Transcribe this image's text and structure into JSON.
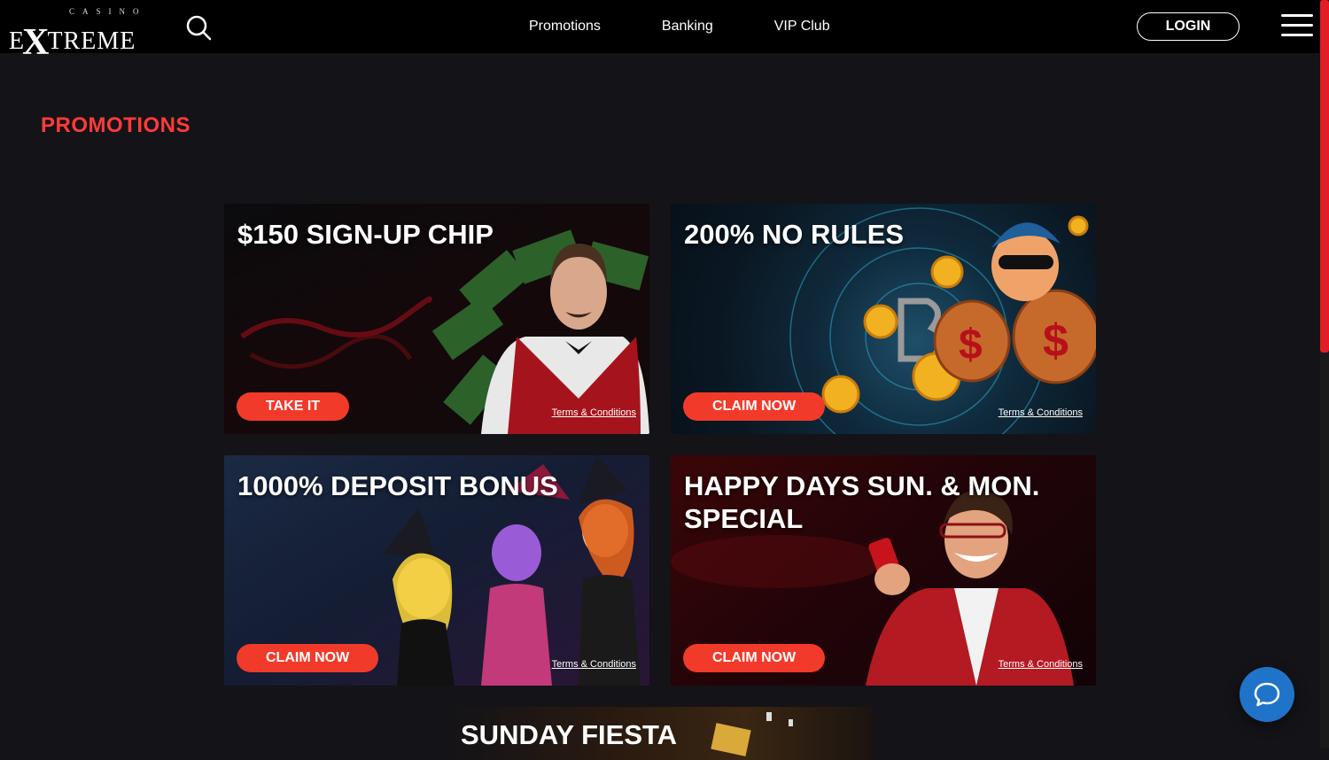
{
  "header": {
    "logo_small": "CASINO",
    "logo_big_pre": "E",
    "logo_big_x": "X",
    "logo_big_post": "TREME",
    "nav": [
      "Promotions",
      "Banking",
      "VIP Club"
    ],
    "login_label": "LOGIN"
  },
  "page": {
    "title": "PROMOTIONS"
  },
  "promotions": [
    {
      "title": "$150 SIGN-UP CHIP",
      "cta": "TAKE IT",
      "terms": "Terms & Conditions"
    },
    {
      "title": "200% NO RULES",
      "cta": "CLAIM NOW",
      "terms": "Terms & Conditions"
    },
    {
      "title": "1000% DEPOSIT BONUS",
      "cta": "CLAIM NOW",
      "terms": "Terms & Conditions"
    },
    {
      "title": "HAPPY DAYS SUN. & MON. SPECIAL",
      "cta": "CLAIM NOW",
      "terms": "Terms & Conditions"
    },
    {
      "title": "SUNDAY FIESTA"
    }
  ],
  "colors": {
    "accent": "#f23a2a",
    "title_red": "#ff3b3b",
    "chat_blue": "#1f74c9"
  }
}
